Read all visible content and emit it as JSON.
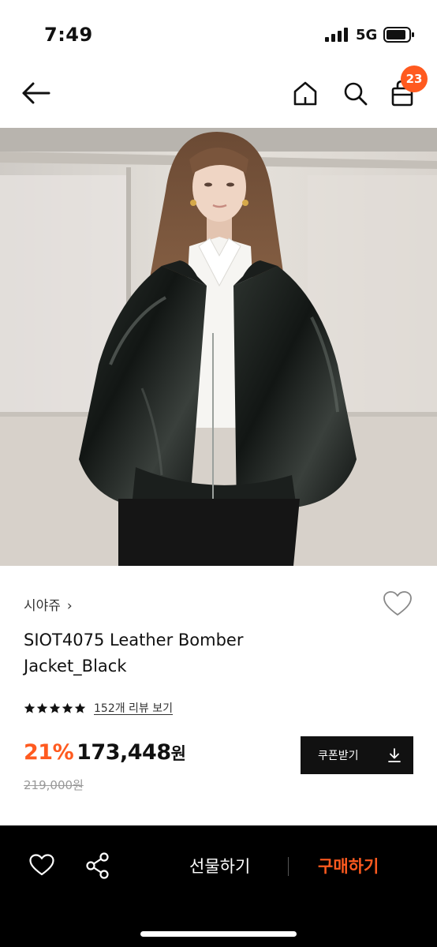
{
  "status_bar": {
    "time": "7:49",
    "network": "5G",
    "icons": [
      "signal-icon",
      "battery-icon"
    ]
  },
  "nav": {
    "icons": [
      "back-arrow-icon",
      "home-icon",
      "search-icon",
      "cart-icon"
    ],
    "cart_count": "23",
    "badge_color": "#ff5a1f"
  },
  "product": {
    "brand": "시야쥬",
    "title_line1": "SIOT4075 Leather Bomber",
    "title_line2": "Jacket_Black",
    "rating": 5,
    "rating_max": 5,
    "review_link": "152개 리뷰 보기",
    "discount": "21%",
    "price": "173,448",
    "price_unit": "원",
    "original_price": "219,000원",
    "coupon_label": "쿠폰받기"
  },
  "bottom_bar": {
    "gift_label": "선물하기",
    "buy_label": "구매하기",
    "icons": [
      "heart-icon",
      "share-icon"
    ]
  },
  "colors": {
    "accent": "#ff5a1f",
    "text": "#111111",
    "bottom_bar": "#000000"
  }
}
